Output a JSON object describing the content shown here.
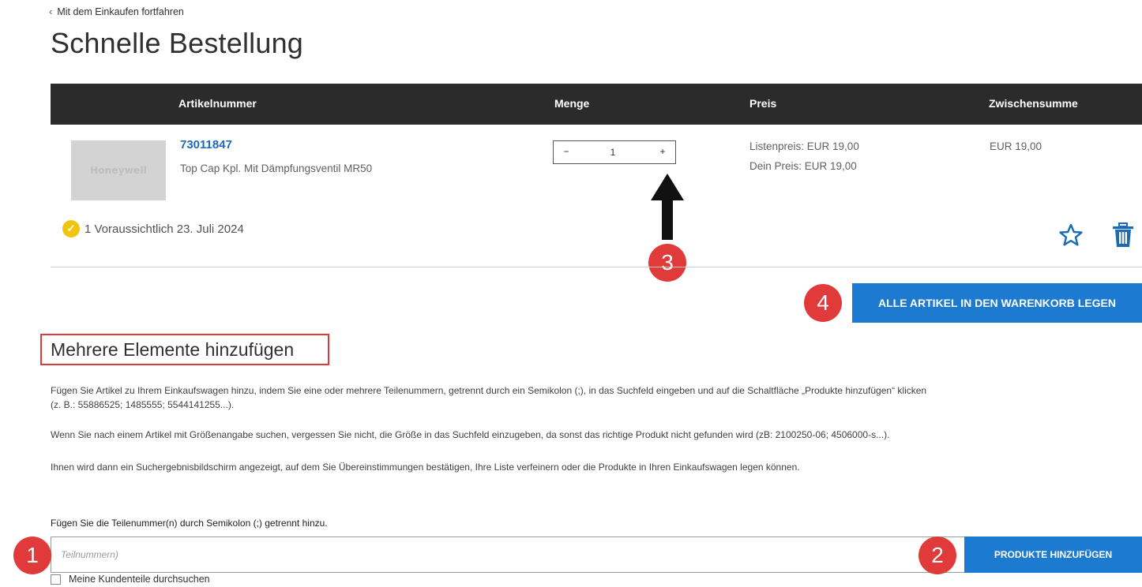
{
  "nav": {
    "back_label": "Mit dem Einkaufen fortfahren"
  },
  "page": {
    "title": "Schnelle Bestellung"
  },
  "table": {
    "headers": {
      "part": "Artikelnummer",
      "qty": "Menge",
      "price": "Preis",
      "subtotal": "Zwischensumme"
    },
    "row": {
      "image_brand": "Honeywell",
      "part_number": "73011847",
      "description": "Top Cap Kpl. Mit Dämpfungsventil MR50",
      "quantity": "1",
      "list_price": "Listenpreis: EUR 19,00",
      "your_price": "Dein Preis: EUR 19,00",
      "subtotal": "EUR 19,00",
      "availability": "1 Voraussichtlich 23. Juli 2024"
    },
    "qty_minus": "−",
    "qty_plus": "+"
  },
  "annotations": {
    "badge1": "1",
    "badge2": "2",
    "badge3": "3",
    "badge4": "4"
  },
  "actions": {
    "add_all_to_cart": "ALLE ARTIKEL IN DEN WARENKORB LEGEN"
  },
  "bulk": {
    "title": "Mehrere Elemente hinzufügen",
    "para1_line1": "Fügen Sie Artikel zu Ihrem Einkaufswagen hinzu, indem Sie eine oder mehrere Teilenummern, getrennt durch ein Semikolon (;), in das Suchfeld eingeben und auf die Schaltfläche „Produkte hinzufügen“ klicken",
    "para1_line2": "(z. B.: 55886525; 1485555; 5544141255...).",
    "para2": "Wenn Sie nach einem Artikel mit Größenangabe suchen, vergessen Sie nicht, die Größe in das Suchfeld einzugeben, da sonst das richtige Produkt nicht gefunden wird (zB: 2100250-06; 4506000-s...).",
    "para3": "Ihnen wird dann ein Suchergebnisbildschirm angezeigt, auf dem Sie Übereinstimmungen bestätigen, Ihre Liste verfeinern oder die Produkte in Ihren Einkaufswagen legen können.",
    "input_label": "Fügen Sie die Teilenummer(n) durch Semikolon (;) getrennt hinzu.",
    "input_placeholder": "Teilnummern)",
    "add_button": "PRODUKTE HINZUFÜGEN",
    "checkbox_label": "Meine Kundenteile durchsuchen"
  },
  "colors": {
    "accent": "#1c7bd1",
    "link": "#1c6ab4",
    "header_bg": "#2b2b2b",
    "badge": "#e03a3a",
    "highlight_border": "#d93a3a",
    "check": "#f1c40f"
  }
}
